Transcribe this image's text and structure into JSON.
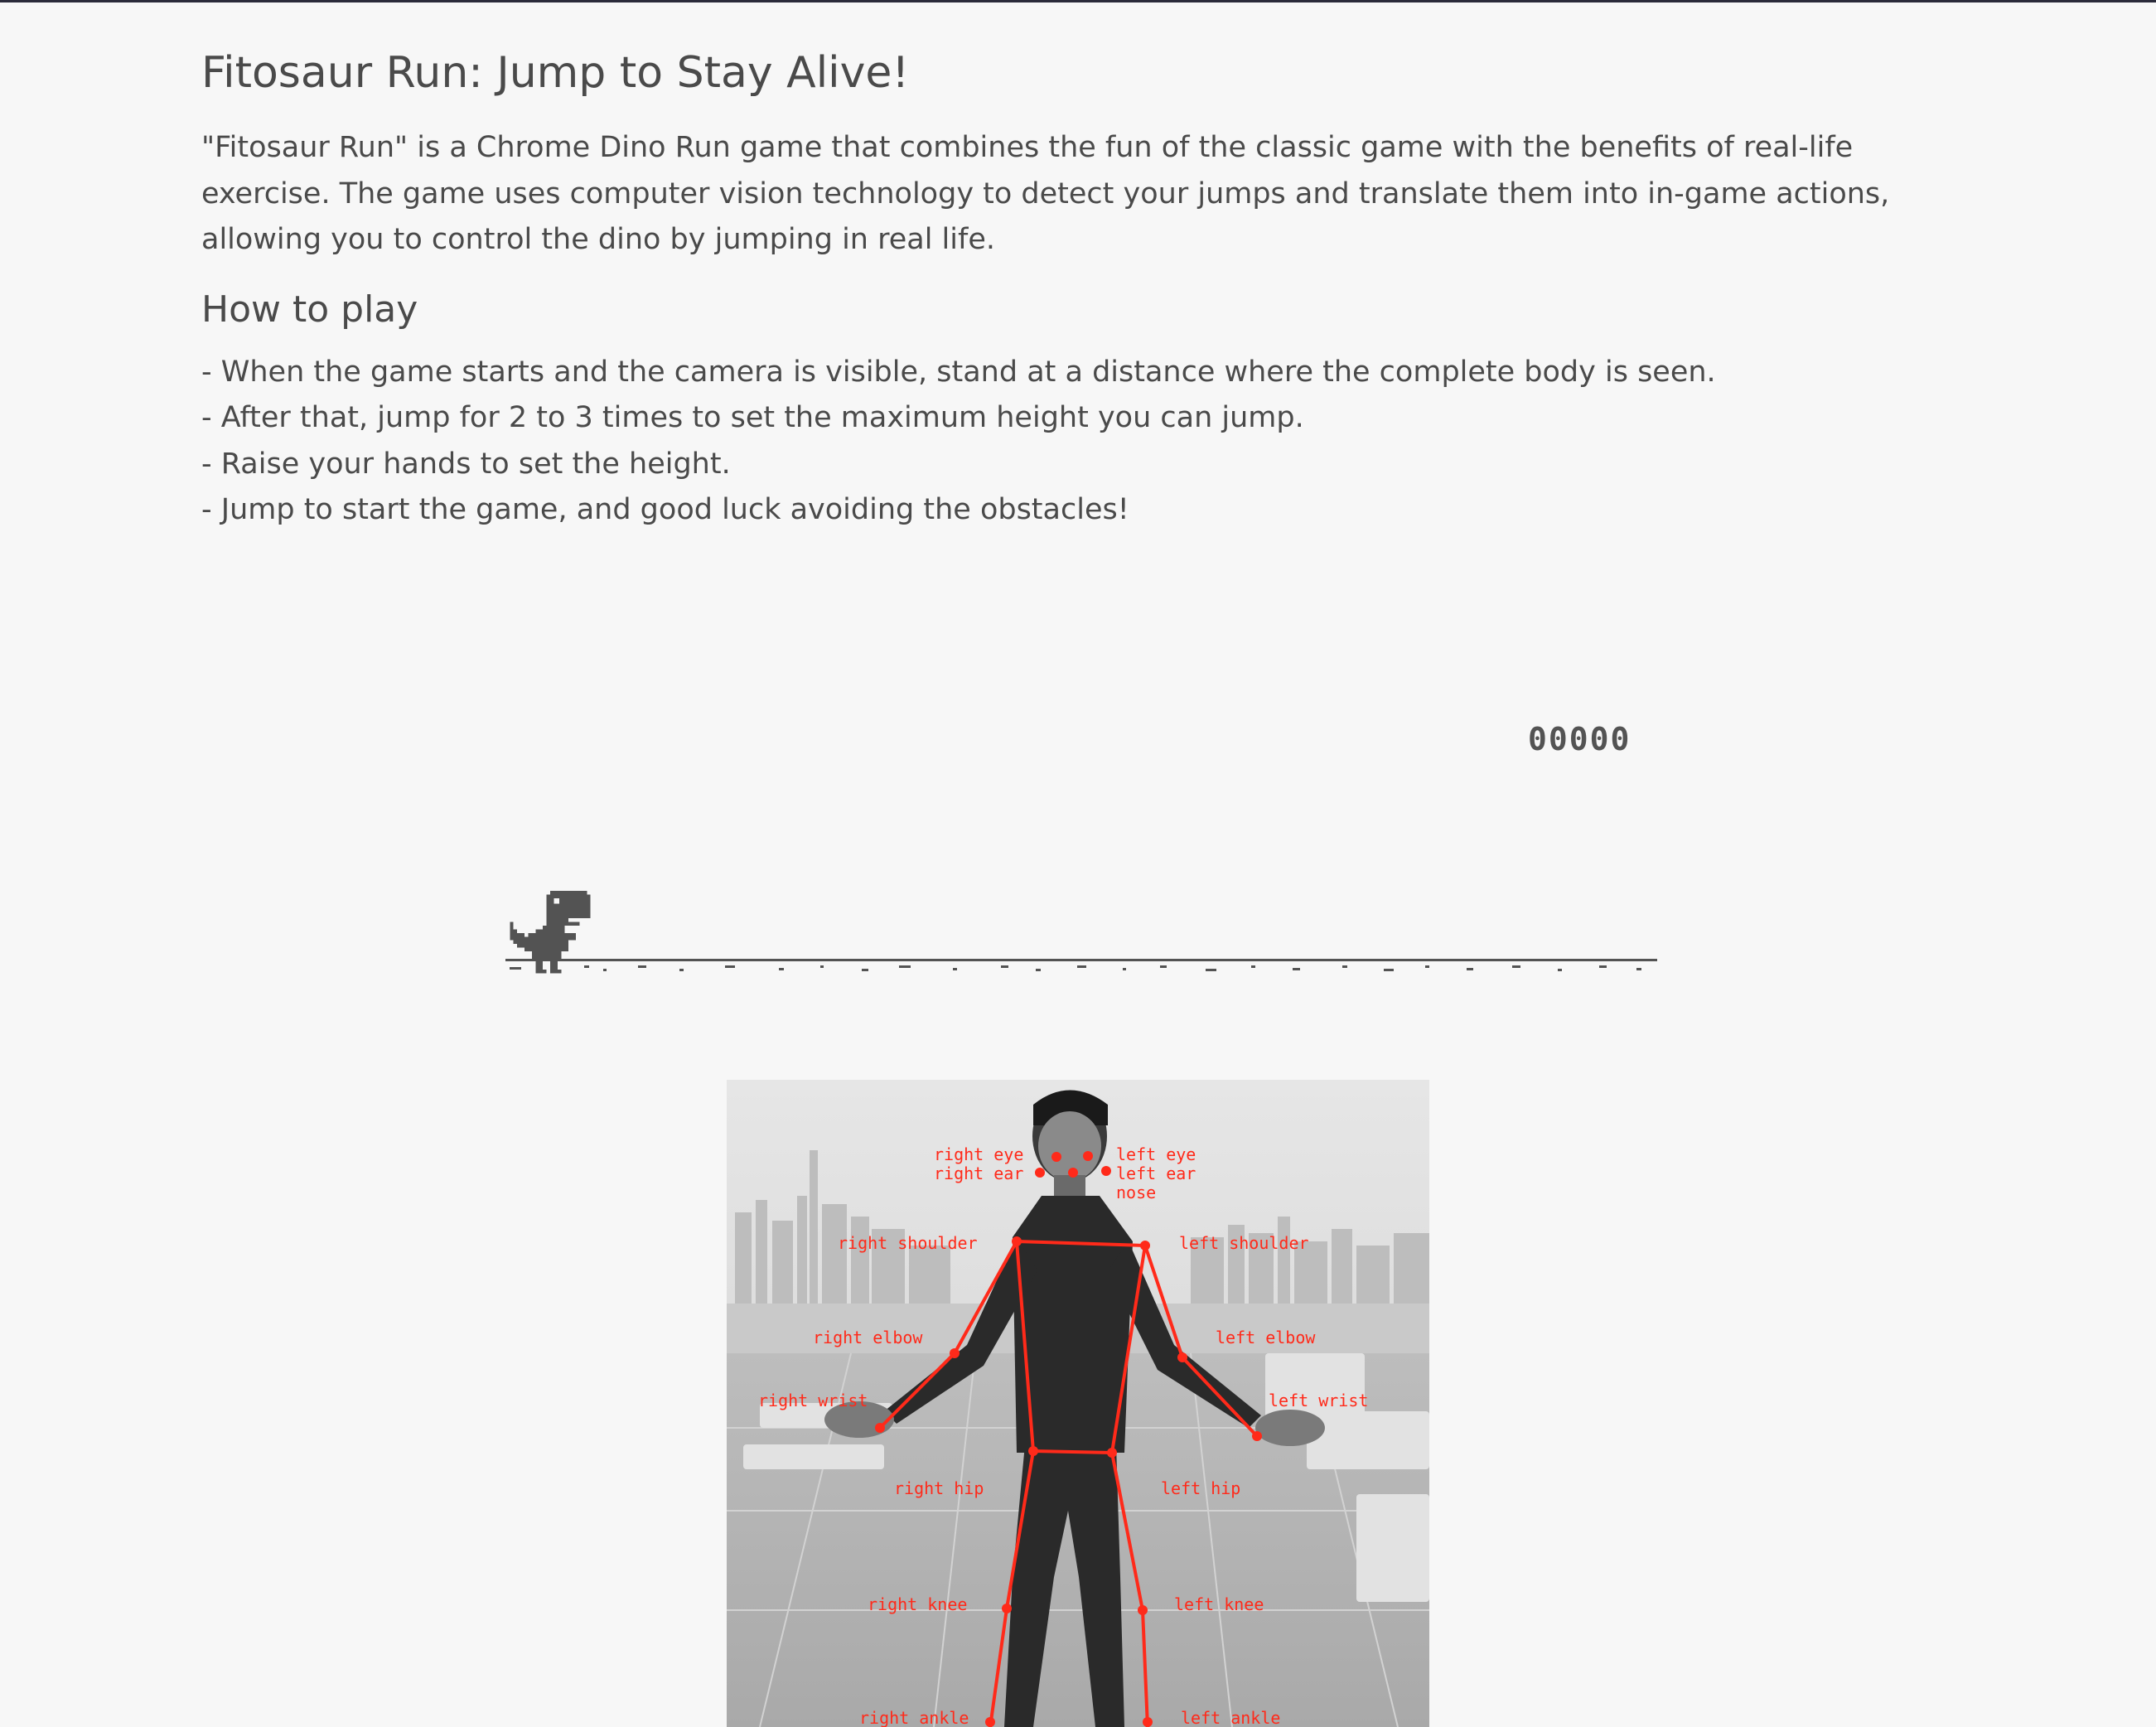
{
  "page": {
    "title": "Fitosaur Run: Jump to Stay Alive!",
    "intro": "\"Fitosaur Run\" is a Chrome Dino Run game that combines the fun of the classic game with the benefits of real-life exercise. The game uses computer vision technology to detect your jumps and translate them into in-game actions, allowing you to control the dino by jumping in real life.",
    "how_to_play": {
      "heading": "How to play",
      "steps": [
        "- When the game starts and the camera is visible, stand at a distance where the complete body is seen.",
        "- After that, jump for 2 to 3 times to set the maximum height you can jump.",
        "- Raise your hands to set the height.",
        "- Jump to start the game, and good luck avoiding the obstacles!"
      ]
    }
  },
  "game": {
    "score": "00000",
    "color": "#535353"
  },
  "pose_image": {
    "keypoint_color": "#ff2a1a",
    "labels": {
      "right_eye": "right eye",
      "left_eye": "left eye",
      "right_ear": "right ear",
      "left_ear": "left ear",
      "nose": "nose",
      "right_shoulder": "right shoulder",
      "left_shoulder": "left shoulder",
      "right_elbow": "right elbow",
      "left_elbow": "left elbow",
      "right_wrist": "right wrist",
      "left_wrist": "left wrist",
      "right_hip": "right hip",
      "left_hip": "left hip",
      "right_knee": "right knee",
      "left_knee": "left knee",
      "right_ankle": "right ankle",
      "left_ankle": "left ankle"
    }
  }
}
